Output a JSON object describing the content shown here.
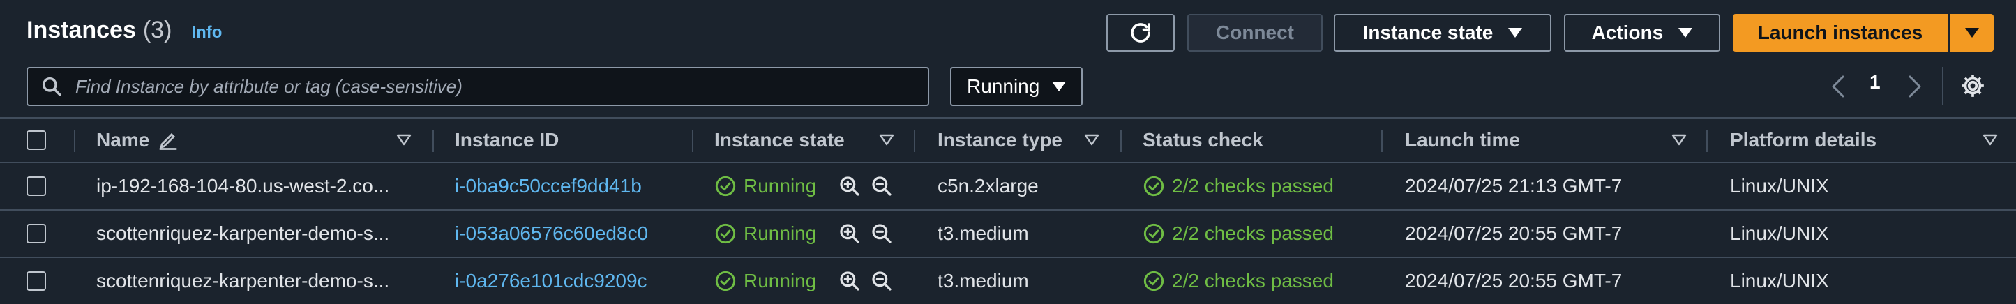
{
  "header": {
    "title": "Instances",
    "count": "(3)",
    "info": "Info"
  },
  "toolbar": {
    "connect": "Connect",
    "instance_state": "Instance state",
    "actions": "Actions",
    "launch": "Launch instances"
  },
  "search": {
    "placeholder": "Find Instance by attribute or tag (case-sensitive)",
    "filter_value": "Running"
  },
  "pagination": {
    "page": "1"
  },
  "columns": [
    "Name",
    "Instance ID",
    "Instance state",
    "Instance type",
    "Status check",
    "Launch time",
    "Platform details"
  ],
  "rows": [
    {
      "name": "ip-192-168-104-80.us-west-2.co...",
      "id": "i-0ba9c50ccef9dd41b",
      "state": "Running",
      "type": "c5n.2xlarge",
      "status": "2/2 checks passed",
      "launch": "2024/07/25 21:13 GMT-7",
      "platform": "Linux/UNIX"
    },
    {
      "name": "scottenriquez-karpenter-demo-s...",
      "id": "i-053a06576c60ed8c0",
      "state": "Running",
      "type": "t3.medium",
      "status": "2/2 checks passed",
      "launch": "2024/07/25 20:55 GMT-7",
      "platform": "Linux/UNIX"
    },
    {
      "name": "scottenriquez-karpenter-demo-s...",
      "id": "i-0a276e101cdc9209c",
      "state": "Running",
      "type": "t3.medium",
      "status": "2/2 checks passed",
      "launch": "2024/07/25 20:55 GMT-7",
      "platform": "Linux/UNIX"
    }
  ],
  "colors": {
    "background": "#1b232d",
    "primary": "#f39a22",
    "link": "#5fb7ef",
    "success": "#6fbd44",
    "border": "#414d5c"
  }
}
